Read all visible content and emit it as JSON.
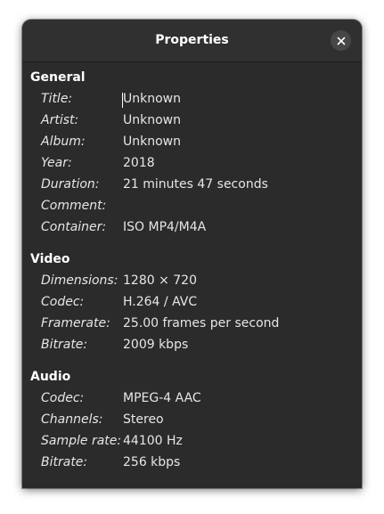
{
  "window": {
    "title": "Properties"
  },
  "sections": {
    "general": {
      "heading": "General",
      "rows": [
        {
          "label": "Title:",
          "value": "Unknown"
        },
        {
          "label": "Artist:",
          "value": "Unknown"
        },
        {
          "label": "Album:",
          "value": "Unknown"
        },
        {
          "label": "Year:",
          "value": "2018"
        },
        {
          "label": "Duration:",
          "value": "21 minutes 47 seconds"
        },
        {
          "label": "Comment:",
          "value": ""
        },
        {
          "label": "Container:",
          "value": "ISO MP4/M4A"
        }
      ]
    },
    "video": {
      "heading": "Video",
      "rows": [
        {
          "label": "Dimensions:",
          "value": "1280 × 720"
        },
        {
          "label": "Codec:",
          "value": "H.264 / AVC"
        },
        {
          "label": "Framerate:",
          "value": "25.00 frames per second"
        },
        {
          "label": "Bitrate:",
          "value": "2009 kbps"
        }
      ]
    },
    "audio": {
      "heading": "Audio",
      "rows": [
        {
          "label": "Codec:",
          "value": "MPEG-4 AAC"
        },
        {
          "label": "Channels:",
          "value": "Stereo"
        },
        {
          "label": "Sample rate:",
          "value": "44100 Hz"
        },
        {
          "label": "Bitrate:",
          "value": "256 kbps"
        }
      ]
    }
  },
  "icons": {
    "close": "close-icon"
  },
  "colors": {
    "window_bg": "#2b2b2b",
    "titlebar_bg": "#303030",
    "close_bg": "#474747",
    "text": "#e6e6e6"
  }
}
